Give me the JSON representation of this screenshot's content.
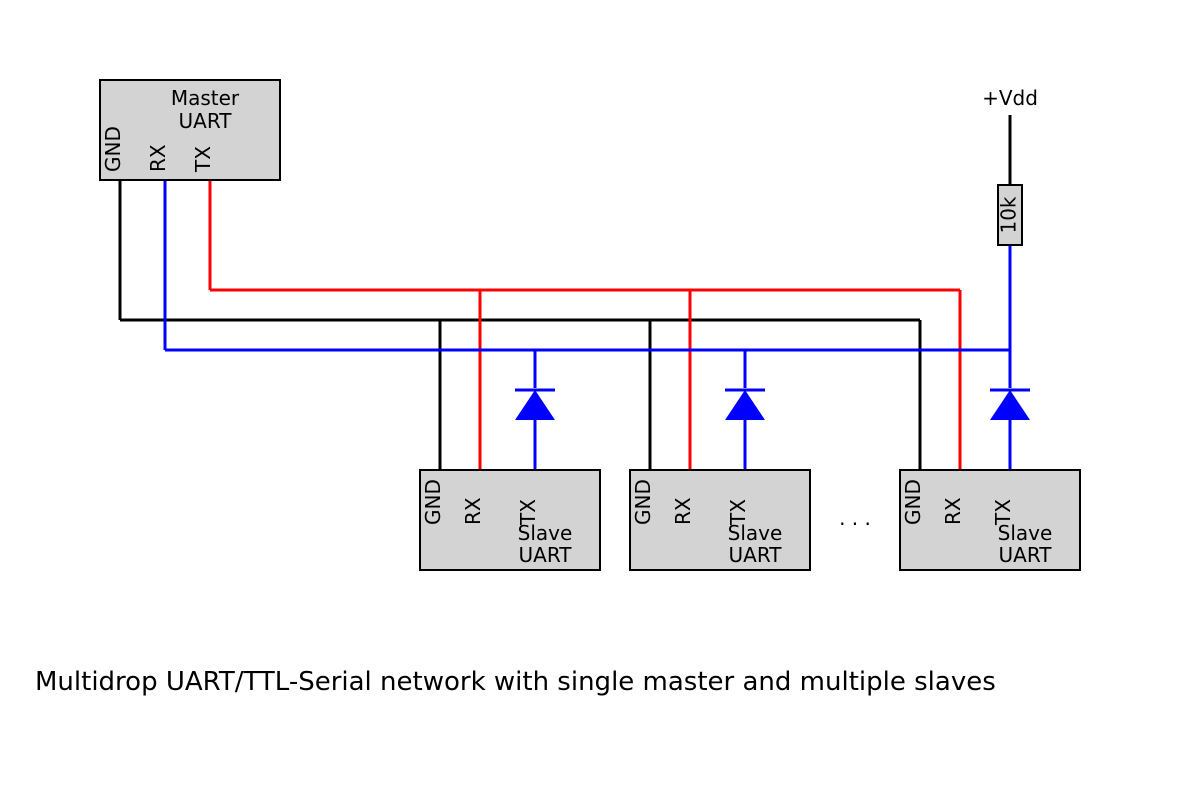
{
  "caption": "Multidrop UART/TTL-Serial network with single master and multiple slaves",
  "master": {
    "title1": "Master",
    "title2": "UART",
    "pins": {
      "gnd": "GND",
      "rx": "RX",
      "tx": "TX"
    }
  },
  "slave": {
    "title1": "Slave",
    "title2": "UART",
    "pins": {
      "gnd": "GND",
      "rx": "RX",
      "tx": "TX"
    }
  },
  "vdd_label": "+Vdd",
  "resistor_label": "10k",
  "ellipsis": ". . ."
}
